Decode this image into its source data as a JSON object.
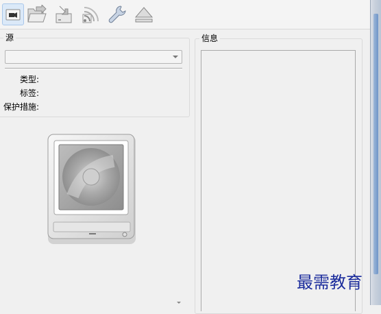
{
  "toolbar": {
    "buttons": [
      {
        "name": "video-camera-icon"
      },
      {
        "name": "open-folder-icon"
      },
      {
        "name": "save-to-drive-icon"
      },
      {
        "name": "rss-feed-icon"
      },
      {
        "name": "wrench-icon"
      },
      {
        "name": "eject-icon"
      }
    ]
  },
  "source": {
    "group_title": "源",
    "combo_value": "",
    "type_label": "类型:",
    "tag_label": "标签:",
    "protection_label": "保护措施:"
  },
  "info": {
    "group_title": "信息",
    "text": ""
  },
  "watermark": "最需教育"
}
